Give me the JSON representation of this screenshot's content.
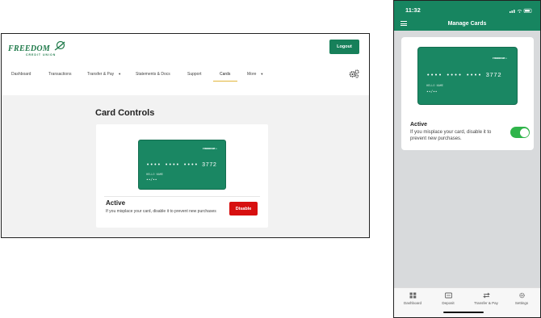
{
  "desktop": {
    "logo": {
      "name": "FREEDOM",
      "tagline": "CREDIT UNION"
    },
    "logout_label": "Logout",
    "nav": [
      {
        "label": "Dashboard"
      },
      {
        "label": "Transactions"
      },
      {
        "label": "Transfer & Pay",
        "dropdown": true
      },
      {
        "label": "Statements & Docs"
      },
      {
        "label": "Support"
      },
      {
        "label": "Cards",
        "active": true
      },
      {
        "label": "More",
        "dropdown": true
      }
    ],
    "page_title": "Card Controls",
    "card": {
      "number_masked": "•••• •••• •••• 3772",
      "name": "HELLO NAME",
      "expiry": "••/••"
    },
    "status_title": "Active",
    "status_description": "If you misplace your card, disable it to prevent new purchases",
    "disable_label": "Disable"
  },
  "mobile": {
    "time": "11:32",
    "title": "Manage Cards",
    "card": {
      "number_masked": "•••• •••• •••• 3772",
      "name": "HELLO NAME",
      "expiry": "••/••"
    },
    "status_title": "Active",
    "status_description": "If you misplace your card, disable it to prevent new purchases.",
    "toggle_on": true,
    "tabs": [
      {
        "label": "Dashboard",
        "icon": "grid-icon"
      },
      {
        "label": "Deposit",
        "icon": "deposit-icon"
      },
      {
        "label": "Transfer & Pay",
        "icon": "transfer-icon"
      },
      {
        "label": "Settings",
        "icon": "gear-icon"
      }
    ]
  },
  "colors": {
    "brand_green": "#178560",
    "card_green": "#1a8763",
    "disable_red": "#d70f0f",
    "toggle_green": "#2fb44a",
    "nav_active_underline": "#e2b53a"
  }
}
